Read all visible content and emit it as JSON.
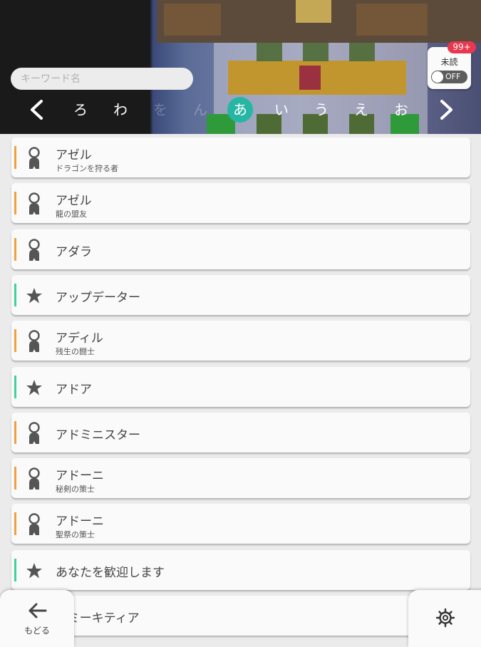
{
  "search": {
    "placeholder": "キーワード名",
    "value": ""
  },
  "unread": {
    "label": "未読",
    "badge": "99+",
    "toggle": "OFF"
  },
  "kana_nav": {
    "prev_icon": "chevron-left-icon",
    "next_icon": "chevron-right-icon",
    "items": [
      {
        "label": "ろ",
        "state": "normal"
      },
      {
        "label": "わ",
        "state": "normal"
      },
      {
        "label": "を",
        "state": "dim"
      },
      {
        "label": "ん",
        "state": "dim"
      },
      {
        "label": "あ",
        "state": "active"
      },
      {
        "label": "い",
        "state": "normal"
      },
      {
        "label": "う",
        "state": "normal"
      },
      {
        "label": "え",
        "state": "normal"
      },
      {
        "label": "お",
        "state": "normal"
      }
    ]
  },
  "colors": {
    "accent": "#27b5a4",
    "person_bar": "#f0a040",
    "star_bar": "#3fd39a",
    "badge": "#e8384f"
  },
  "entries": [
    {
      "type": "person",
      "icon": "person-icon",
      "title": "アゼル",
      "subtitle": "ドラゴンを狩る者"
    },
    {
      "type": "person",
      "icon": "person-icon",
      "title": "アゼル",
      "subtitle": "龍の盟友"
    },
    {
      "type": "person",
      "icon": "person-icon",
      "title": "アダラ",
      "subtitle": ""
    },
    {
      "type": "star",
      "icon": "star-icon",
      "title": "アップデーター",
      "subtitle": ""
    },
    {
      "type": "person",
      "icon": "person-icon",
      "title": "アディル",
      "subtitle": "残生の闘士"
    },
    {
      "type": "star",
      "icon": "star-icon",
      "title": "アドア",
      "subtitle": ""
    },
    {
      "type": "person",
      "icon": "person-icon",
      "title": "アドミニスター",
      "subtitle": ""
    },
    {
      "type": "person",
      "icon": "person-icon",
      "title": "アドーニ",
      "subtitle": "秘剣の策士"
    },
    {
      "type": "person",
      "icon": "person-icon",
      "title": "アドーニ",
      "subtitle": "聖祭の策士"
    },
    {
      "type": "star",
      "icon": "star-icon",
      "title": "あなたを歓迎します",
      "subtitle": ""
    },
    {
      "type": "person",
      "icon": "person-icon",
      "title": "アミーキティア",
      "subtitle": ""
    }
  ],
  "footer": {
    "back_label": "もどる",
    "back_icon": "arrow-left-icon",
    "settings_icon": "gear-icon"
  }
}
